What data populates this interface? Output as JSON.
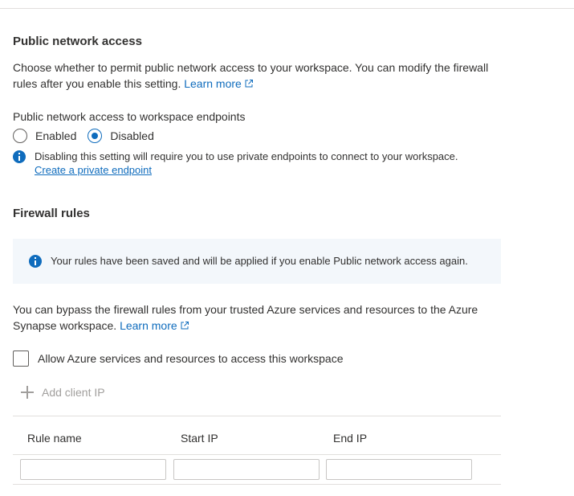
{
  "public_access": {
    "title": "Public network access",
    "description": "Choose whether to permit public network access to your workspace. You can modify the firewall rules after you enable this setting.",
    "learn_more": "Learn more",
    "field_label": "Public network access to workspace endpoints",
    "options": [
      {
        "label": "Enabled",
        "selected": false
      },
      {
        "label": "Disabled",
        "selected": true
      }
    ],
    "note": "Disabling this setting will require you to use private endpoints to connect to your workspace.",
    "create_endpoint_link": "Create a private endpoint"
  },
  "firewall": {
    "title": "Firewall rules",
    "banner_text": "Your rules have been saved and will be applied if you enable Public network access again.",
    "bypass_text": "You can bypass the firewall rules from your trusted Azure services and resources to the Azure Synapse workspace.",
    "learn_more": "Learn more",
    "allow_checkbox_label": "Allow Azure services and resources to access this workspace",
    "allow_checked": false,
    "add_client_ip": "Add client IP",
    "table": {
      "columns": [
        "Rule name",
        "Start IP",
        "End IP"
      ],
      "row": {
        "rule_name": "",
        "start_ip": "",
        "end_ip": ""
      }
    }
  },
  "colors": {
    "accent": "#0f6cbd",
    "banner_bg": "#f3f7fb",
    "disabled_text": "#a19f9d"
  }
}
